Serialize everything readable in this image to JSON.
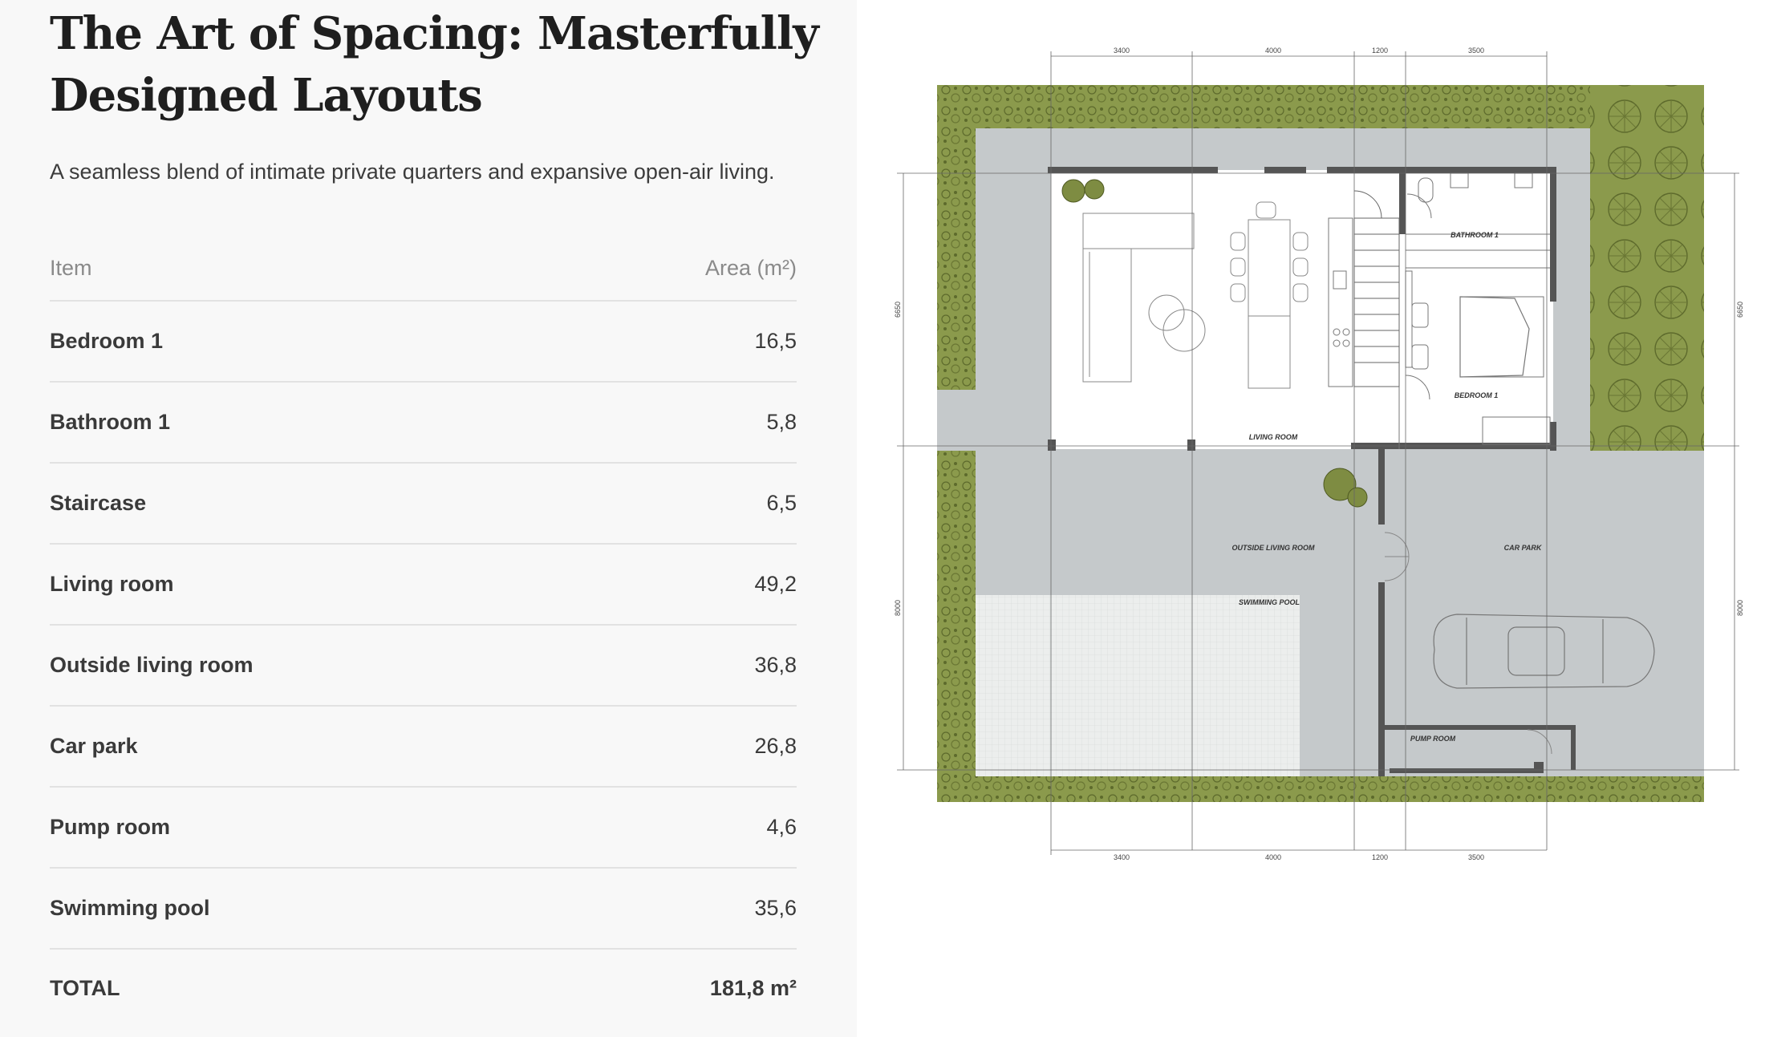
{
  "title": "The Art of Spacing: Masterfully Designed Layouts",
  "subtitle": "A seamless blend of intimate private quarters and expansive open-air living.",
  "table": {
    "header_item": "Item",
    "header_area": "Area (m²)",
    "rows": [
      {
        "name": "Bedroom 1",
        "area": "16,5"
      },
      {
        "name": "Bathroom 1",
        "area": "5,8"
      },
      {
        "name": "Staircase",
        "area": "6,5"
      },
      {
        "name": "Living room",
        "area": "49,2"
      },
      {
        "name": "Outside living room",
        "area": "36,8"
      },
      {
        "name": "Car park",
        "area": "26,8"
      },
      {
        "name": "Pump room",
        "area": "4,6"
      },
      {
        "name": "Swimming pool",
        "area": "35,6"
      }
    ],
    "total_label": "TOTAL",
    "total_value": "181,8 m²"
  },
  "plan": {
    "labels": {
      "bathroom": "BATHROOM 1",
      "bedroom": "BEDROOM 1",
      "living": "LIVING ROOM",
      "outside": "OUTSIDE LIVING ROOM",
      "carpark": "CAR PARK",
      "pool": "SWIMMING POOL",
      "pump": "PUMP ROOM"
    },
    "dims_top": [
      "3400",
      "4000",
      "1200",
      "3500"
    ],
    "dims_bottom": [
      "3400",
      "4000",
      "1200",
      "3500"
    ],
    "dims_left": [
      "6650",
      "8000"
    ],
    "dims_right": [
      "6650",
      "8000"
    ]
  },
  "colors": {
    "garden": "#8b9a4c",
    "paving": "#c5c9cb",
    "pool": "#e9ecea",
    "wall": "#555555"
  }
}
